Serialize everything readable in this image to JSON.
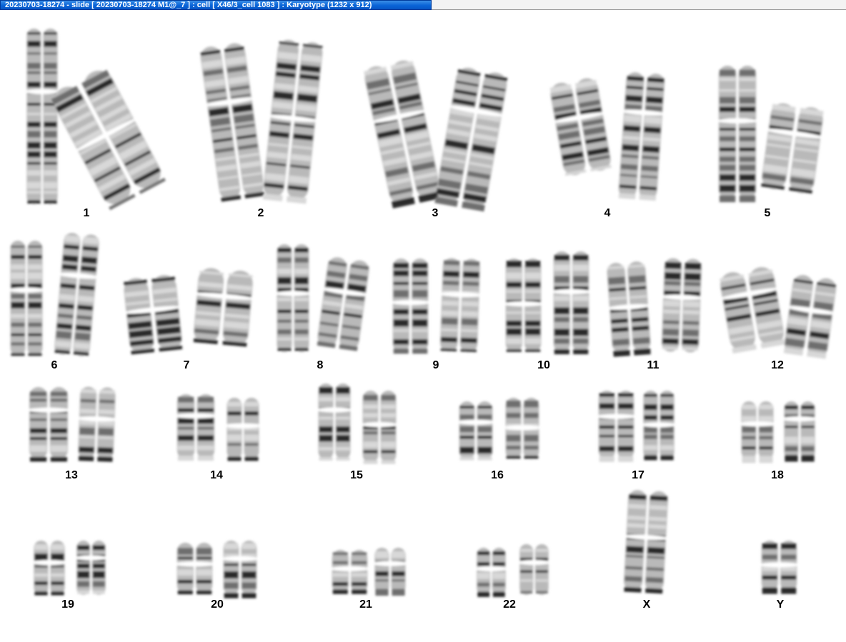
{
  "window": {
    "title": "20230703-18274 - slide [ 20230703-18274 M1@_7 ] : cell [ X46/3_cell 1083 ] : Karyotype  (1232 x 912)"
  },
  "karyotype": {
    "pairs": [
      {
        "id": "1",
        "label": "1",
        "count": 2
      },
      {
        "id": "2",
        "label": "2",
        "count": 2
      },
      {
        "id": "3",
        "label": "3",
        "count": 2
      },
      {
        "id": "4",
        "label": "4",
        "count": 2
      },
      {
        "id": "5",
        "label": "5",
        "count": 2
      },
      {
        "id": "6",
        "label": "6",
        "count": 2
      },
      {
        "id": "7",
        "label": "7",
        "count": 2
      },
      {
        "id": "8",
        "label": "8",
        "count": 2
      },
      {
        "id": "9",
        "label": "9",
        "count": 2
      },
      {
        "id": "10",
        "label": "10",
        "count": 2
      },
      {
        "id": "11",
        "label": "11",
        "count": 2
      },
      {
        "id": "12",
        "label": "12",
        "count": 2
      },
      {
        "id": "13",
        "label": "13",
        "count": 2
      },
      {
        "id": "14",
        "label": "14",
        "count": 2
      },
      {
        "id": "15",
        "label": "15",
        "count": 2
      },
      {
        "id": "16",
        "label": "16",
        "count": 2
      },
      {
        "id": "17",
        "label": "17",
        "count": 2
      },
      {
        "id": "18",
        "label": "18",
        "count": 2
      },
      {
        "id": "19",
        "label": "19",
        "count": 2
      },
      {
        "id": "20",
        "label": "20",
        "count": 2
      },
      {
        "id": "21",
        "label": "21",
        "count": 2
      },
      {
        "id": "22",
        "label": "22",
        "count": 2
      },
      {
        "id": "X",
        "label": "X",
        "count": 1
      },
      {
        "id": "Y",
        "label": "Y",
        "count": 1
      }
    ]
  }
}
